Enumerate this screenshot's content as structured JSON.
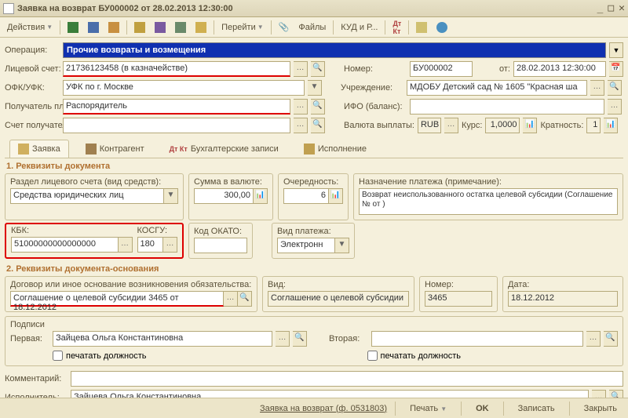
{
  "window": {
    "title": "Заявка на возврат БУ000002 от 28.02.2013 12:30:00"
  },
  "toolbar": {
    "actions": "Действия",
    "go": "Перейти",
    "files": "Файлы",
    "kud": "КУД и Р..."
  },
  "header": {
    "operation_lbl": "Операция:",
    "operation": "Прочие возвраты и возмещения",
    "account_lbl": "Лицевой счет:",
    "account": "21736123458 (в казначействе)",
    "ofk_lbl": "ОФК/УФК:",
    "ofk": "УФК по г. Москве",
    "payee_lbl": "Получатель платежа:",
    "payee": "Распорядитель",
    "payee_acc_lbl": "Счет получателя:",
    "payee_acc": "",
    "number_lbl": "Номер:",
    "number": "БУ000002",
    "from_lbl": "от:",
    "date": "28.02.2013 12:30:00",
    "org_lbl": "Учреждение:",
    "org": "МДОБУ  Детский сад № 1605 \"Красная ша",
    "ifo_lbl": "ИФО (баланс):",
    "ifo": "",
    "currency_lbl": "Валюта выплаты:",
    "currency": "RUB",
    "rate_lbl": "Курс:",
    "rate": "1,0000",
    "mult_lbl": "Кратность:",
    "mult": "1"
  },
  "tabs": {
    "t1": "Заявка",
    "t2": "Контрагент",
    "t3": "Бухгалтерские записи",
    "t4": "Исполнение"
  },
  "section1": {
    "title": "1. Реквизиты документа",
    "razdel_lbl": "Раздел лицевого счета (вид средств):",
    "razdel": "Средства юридических лиц",
    "sum_lbl": "Сумма в валюте:",
    "sum": "300,00",
    "order_lbl": "Очередность:",
    "order": "6",
    "purpose_lbl": "Назначение платежа (примечание):",
    "purpose": "Возврат неиспользованного остатка целевой субсидии (Соглашение №  от  )",
    "kbk_lbl": "КБК:",
    "kbk": "51000000000000000",
    "kosgu_lbl": "КОСГУ:",
    "kosgu": "180",
    "okato_lbl": "Код ОКАТО:",
    "okato": "",
    "paytype_lbl": "Вид платежа:",
    "paytype": "Электронн"
  },
  "section2": {
    "title": "2. Реквизиты документа-основания",
    "basis_lbl": "Договор или иное основание возникновения обязательства:",
    "basis": "Соглашение о целевой субсидии 3465 от 18.12.2012",
    "kind_lbl": "Вид:",
    "kind": "Соглашение о целевой субсидии",
    "num_lbl": "Номер:",
    "num": "3465",
    "date_lbl": "Дата:",
    "date": "18.12.2012"
  },
  "signatures": {
    "title": "Подписи",
    "first_lbl": "Первая:",
    "first": "Зайцева Ольга Константиновна",
    "second_lbl": "Вторая:",
    "print_lbl": "печатать должность"
  },
  "footer": {
    "comment_lbl": "Комментарий:",
    "exec_lbl": "Исполнитель:",
    "exec": "Зайцева Ольга Константиновна"
  },
  "bottombar": {
    "link": "Заявка на возврат (ф. 0531803)",
    "print": "Печать",
    "ok": "OK",
    "save": "Записать",
    "close": "Закрыть"
  }
}
